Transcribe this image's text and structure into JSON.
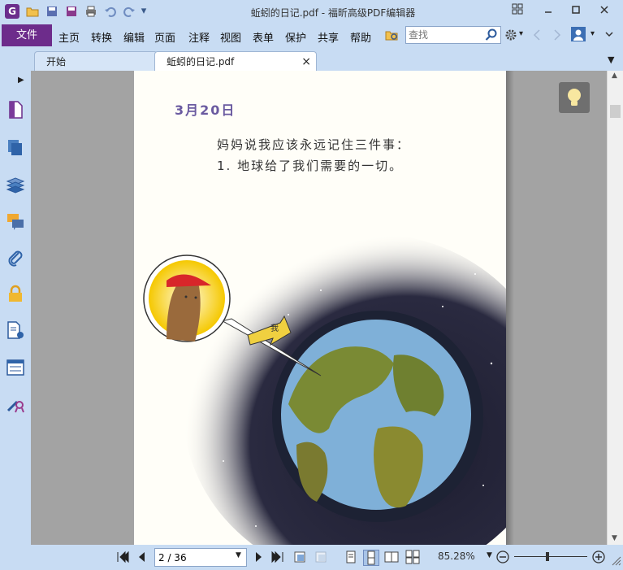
{
  "window": {
    "title": "蚯蚓的日记.pdf - 福昕高级PDF编辑器"
  },
  "menu": {
    "file": "文件",
    "items": [
      "主页",
      "转换",
      "编辑",
      "页面",
      "注释",
      "视图",
      "表单",
      "保护",
      "共享",
      "帮助"
    ]
  },
  "search": {
    "placeholder": "查找"
  },
  "tabs": [
    {
      "label": "开始"
    },
    {
      "label": "蚯蚓的日记.pdf",
      "close": "×"
    }
  ],
  "left_toolbar": [
    "page-thumbnail-icon",
    "pages-icon",
    "layers-icon",
    "comments-icon",
    "attachments-icon",
    "security-icon",
    "document-properties-icon",
    "form-fields-icon",
    "signature-icon"
  ],
  "page_content": {
    "date": "3月20日",
    "line1": "妈妈说我应该永远记住三件事：",
    "line2": "1. 地球给了我们需要的一切。",
    "arrow_label": "我"
  },
  "status": {
    "page_value": "2 / 36",
    "zoom": "85.28%",
    "zoom_level": 0.45
  },
  "colors": {
    "accent": "#6d2c8b",
    "chrome": "#c8dcf3",
    "doc_bg": "#a3a3a3"
  }
}
